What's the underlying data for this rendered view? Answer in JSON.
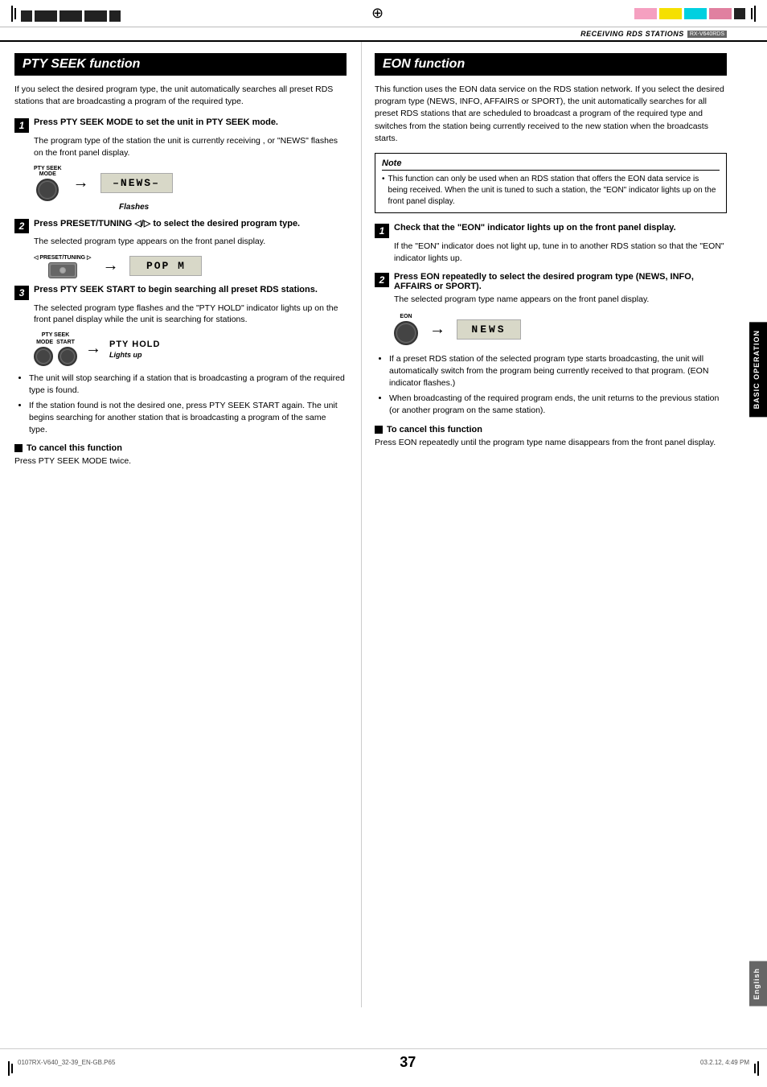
{
  "header": {
    "title": "RECEIVING RDS STATIONS",
    "badge": "RX-V640RDS",
    "crosshair": "⊕"
  },
  "left_section": {
    "title": "PTY SEEK function",
    "intro": "If you select the desired program type, the unit automatically searches all preset RDS stations that are broadcasting a program of the required type.",
    "steps": [
      {
        "num": "1",
        "title": "Press PTY SEEK MODE to set the unit in PTY SEEK mode.",
        "body": "The program type of the station the unit is currently receiving , or \"NEWS\" flashes on the front panel display.",
        "caption": "Flashes",
        "diagram_type": "pty_seek_mode"
      },
      {
        "num": "2",
        "title": "Press PRESET/TUNING ◁/▷ to select the desired program type.",
        "body": "The selected program type appears on the front panel display.",
        "diagram_type": "preset_tuning"
      },
      {
        "num": "3",
        "title": "Press PTY SEEK START to begin searching all preset RDS stations.",
        "body": "The selected program type flashes and the \"PTY HOLD\" indicator lights up on the front panel display while the unit is searching for stations.",
        "caption": "Lights up",
        "diagram_type": "pty_seek_start"
      }
    ],
    "bullets": [
      "The unit will stop searching if a station that is broadcasting a program of the required type is found.",
      "If the station found is not the desired one, press PTY SEEK START again. The unit begins searching for another station that is broadcasting a program of the same type."
    ],
    "cancel": {
      "title": "To cancel this function",
      "body": "Press PTY SEEK MODE twice."
    }
  },
  "right_section": {
    "title": "EON function",
    "intro": "This function uses the EON data service on the RDS station network. If you select the desired program type (NEWS, INFO, AFFAIRS or SPORT), the unit automatically searches for all preset RDS stations that are scheduled to broadcast a program of the required type and switches from the station being currently received to the new station when the broadcasts starts.",
    "note": {
      "title": "Note",
      "body": "This function can only be used when an RDS station that offers the EON data service is being received. When the unit is tuned to such a station, the \"EON\" indicator lights up on the front panel display."
    },
    "steps": [
      {
        "num": "1",
        "title": "Check that the \"EON\" indicator lights up on the front panel display.",
        "body": "If the \"EON\" indicator does not light up, tune in to another RDS station so that the \"EON\" indicator lights up.",
        "diagram_type": "none"
      },
      {
        "num": "2",
        "title": "Press EON repeatedly to select the desired program type (NEWS, INFO, AFFAIRS or SPORT).",
        "body": "The selected program type name appears on the front panel display.",
        "diagram_type": "eon"
      }
    ],
    "bullets": [
      "If a preset RDS station of the selected program type starts broadcasting, the unit will automatically switch from the program being currently received to that program. (EON indicator flashes.)",
      "When broadcasting of the required program ends, the unit returns to the previous station (or another program on the same station)."
    ],
    "cancel": {
      "title": "To cancel this function",
      "body": "Press EON repeatedly until the program type name disappears from the front panel display."
    }
  },
  "side_tab": {
    "label": "BASIC OPERATION"
  },
  "bottom_tab": {
    "label": "English"
  },
  "footer": {
    "left": "0107RX-V640_32-39_EN-GB.P65",
    "center": "37",
    "right": "03.2.12, 4:49 PM"
  },
  "lcd_texts": {
    "news_flashing": "–NEWS–",
    "pop_m": "POP  M",
    "pty_hold": "PTY HOLD",
    "news_eon": "NEWS"
  },
  "colors": {
    "black": "#000000",
    "dark_gray": "#333333",
    "medium_gray": "#666666",
    "light_gray": "#cccccc",
    "lcd_bg": "#d8d8c8",
    "pink": "#f5a0c0",
    "yellow": "#f5e000",
    "cyan": "#00d0e0"
  }
}
